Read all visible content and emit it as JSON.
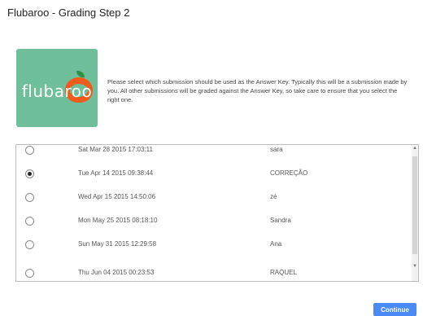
{
  "dialog": {
    "title": "Flubaroo - Grading Step 2"
  },
  "logo": {
    "text": "flubaroo"
  },
  "instructions": "Please select which submission should be used as the Answer Key. Typically this will be a submission made by you. All other submissions will be graded against the Answer Key, so take care to ensure that you select the right one.",
  "submissions": [
    {
      "date": "Sat Mar 28 2015 17:03:11",
      "name": "sara",
      "selected": false
    },
    {
      "date": "Tue Apr 14 2015 09:38:44",
      "name": "CORREÇÃO",
      "selected": true
    },
    {
      "date": "Wed Apr 15 2015 14:50:06",
      "name": "zé",
      "selected": false
    },
    {
      "date": "Mon May 25 2015 08:18:10",
      "name": "Sandra",
      "selected": false
    },
    {
      "date": "Sun May 31 2015 12:29:58",
      "name": "Ana",
      "selected": false
    },
    {
      "date": "Thu Jun 04 2015 00:23:53",
      "name": "RAQUEL",
      "selected": false
    }
  ],
  "buttons": {
    "continue_label": "Continue"
  },
  "colors": {
    "accent": "#4a8af4",
    "logo_bg": "#6fbf9a",
    "apple": "#f05a1a"
  }
}
